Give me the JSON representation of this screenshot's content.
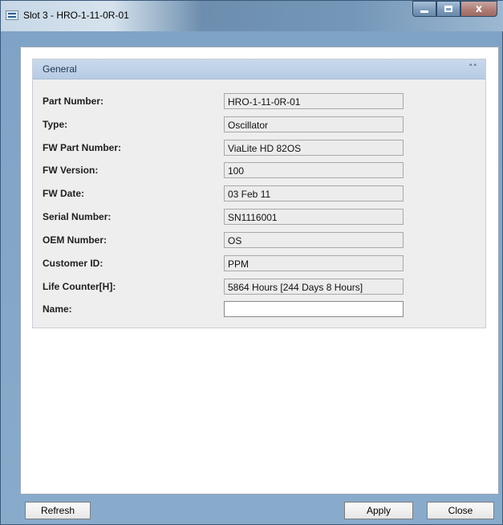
{
  "window": {
    "title": "Slot 3 - HRO-1-11-0R-01",
    "minimize_label": "_",
    "close_label": "x"
  },
  "panel": {
    "title": "General",
    "collapse_icon": "double-chevron-up-icon"
  },
  "fields": [
    {
      "label": "Part Number:",
      "value": "HRO-1-11-0R-01"
    },
    {
      "label": "Type:",
      "value": "Oscillator"
    },
    {
      "label": "FW Part Number:",
      "value": "ViaLite HD 82OS"
    },
    {
      "label": "FW Version:",
      "value": "100"
    },
    {
      "label": "FW Date:",
      "value": "03 Feb 11"
    },
    {
      "label": "Serial Number:",
      "value": "SN1116001"
    },
    {
      "label": "OEM Number:",
      "value": "OS"
    },
    {
      "label": "Customer ID:",
      "value": "PPM"
    },
    {
      "label": "Life Counter[H]:",
      "value": "5864 Hours [244 Days 8 Hours]"
    },
    {
      "label": "Name:",
      "value": ""
    }
  ],
  "buttons": {
    "refresh": "Refresh",
    "apply": "Apply",
    "close": "Close"
  },
  "colors": {
    "panel_header": "#b6cbe3",
    "window_frame": "#7fa3c6",
    "close_button": "#b07d76"
  }
}
